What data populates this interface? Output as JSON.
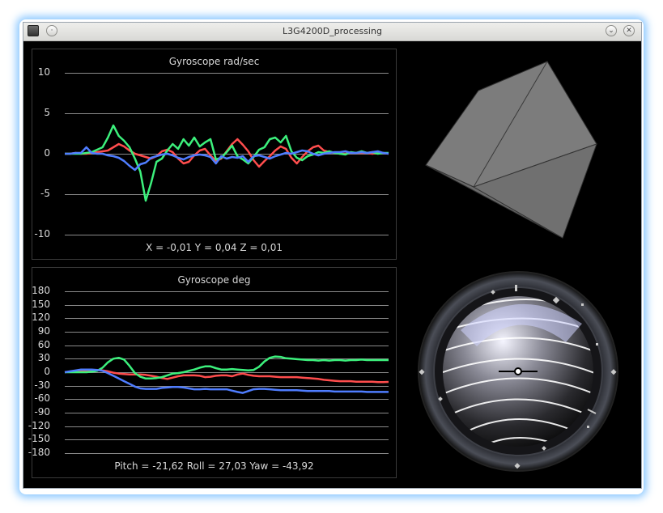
{
  "window": {
    "title": "L3G4200D_processing"
  },
  "colors": {
    "x_series": "#ff4d4d",
    "y_series": "#3cf07c",
    "z_series": "#4f7dff",
    "grid": "#8a8a8a",
    "text": "#d8d8d8"
  },
  "icons": {
    "app": "app-icon",
    "menu": "menu-icon",
    "minimize": "chevron-down-icon",
    "close": "close-icon"
  },
  "chart_data": [
    {
      "type": "line",
      "title": "Gyroscope rad/sec",
      "xlabel": "",
      "ylabel": "",
      "ylim": [
        -10,
        10
      ],
      "y_ticks": [
        "10",
        "5",
        "0",
        "-5",
        "-10"
      ],
      "grid": true,
      "readout": "X = -0,01  Y = 0,04  Z = 0,01",
      "series": [
        {
          "color": "#ff4d4d",
          "values": [
            0,
            0,
            0.1,
            0,
            0,
            0.1,
            0.2,
            0.3,
            0.4,
            0.8,
            1.2,
            0.9,
            0.4,
            0,
            -0.2,
            -0.4,
            -0.6,
            -0.3,
            0.3,
            0.5,
            0.2,
            -0.6,
            -1.2,
            -1.0,
            -0.2,
            0.4,
            0.6,
            -0.2,
            -0.9,
            -0.6,
            0.3,
            1.2,
            1.8,
            1.1,
            0.3,
            -0.8,
            -1.6,
            -0.9,
            -0.3,
            0.4,
            0.9,
            0.6,
            -0.5,
            -1.2,
            -0.4,
            0.3,
            0.8,
            1.0,
            0.4,
            0.2,
            0.1,
            0,
            0,
            0.1,
            0.1,
            0.1,
            0.1,
            0,
            0.1,
            0.1,
            0
          ]
        },
        {
          "color": "#3cf07c",
          "values": [
            0,
            0,
            0,
            0,
            0.1,
            0.2,
            0.5,
            0.8,
            2.0,
            3.5,
            2.2,
            1.6,
            0.8,
            -0.6,
            -2.2,
            -5.8,
            -3.6,
            -1.0,
            -0.6,
            0.4,
            1.2,
            0.6,
            1.8,
            1.0,
            2.0,
            0.9,
            1.4,
            1.8,
            -0.7,
            -0.5,
            0.2,
            1.0,
            -0.3,
            -0.7,
            -1.2,
            -0.4,
            0.5,
            0.8,
            1.8,
            2.0,
            1.4,
            2.2,
            0.3,
            -0.5,
            -0.8,
            -0.3,
            -0.1,
            0.2,
            0.1,
            0.3,
            0.1,
            0,
            -0.1,
            0.2,
            0.1,
            0.3,
            0.1,
            0.2,
            0,
            0.1,
            0.1
          ]
        },
        {
          "color": "#4f7dff",
          "values": [
            0,
            0,
            0.1,
            0.1,
            0.8,
            0.1,
            0,
            0,
            -0.2,
            -0.3,
            -0.5,
            -0.9,
            -1.5,
            -2.0,
            -1.3,
            -1.1,
            -0.5,
            -0.3,
            -0.1,
            0,
            -0.2,
            -0.5,
            -0.7,
            -0.4,
            -0.2,
            -0.1,
            -0.2,
            -0.4,
            -1.2,
            -0.3,
            -0.6,
            -0.4,
            -0.5,
            -0.3,
            -1.0,
            -0.3,
            -0.2,
            -0.4,
            -0.6,
            -0.3,
            -0.1,
            0.1,
            0,
            0.2,
            0.4,
            0.3,
            0,
            -0.2,
            0,
            0.1,
            0.2,
            0.2,
            0.3,
            0.1,
            0.1,
            0.2,
            0.1,
            0.2,
            0.3,
            0.1,
            0
          ]
        }
      ]
    },
    {
      "type": "line",
      "title": "Gyroscope deg",
      "xlabel": "",
      "ylabel": "",
      "ylim": [
        -180,
        180
      ],
      "y_ticks": [
        "180",
        "150",
        "120",
        "90",
        "60",
        "30",
        "0",
        "-30",
        "-60",
        "-90",
        "-120",
        "-150",
        "-180"
      ],
      "grid": true,
      "readout": "Pitch = -21,62  Roll = 27,03  Yaw = -43,92",
      "series": [
        {
          "color": "#ff4d4d",
          "values": [
            0,
            1,
            2,
            3,
            4,
            5,
            5,
            4,
            2,
            -1,
            -3,
            -4,
            -5,
            -5,
            -5,
            -6,
            -8,
            -10,
            -13,
            -15,
            -12,
            -9,
            -7,
            -7,
            -7,
            -8,
            -11,
            -10,
            -8,
            -7,
            -7,
            -9,
            -5,
            -3,
            -6,
            -8,
            -9,
            -9,
            -9,
            -10,
            -11,
            -11,
            -11,
            -11,
            -12,
            -13,
            -14,
            -15,
            -17,
            -18,
            -19,
            -20,
            -20,
            -20,
            -21,
            -21,
            -21,
            -21,
            -22,
            -22,
            -21.6
          ]
        },
        {
          "color": "#3cf07c",
          "values": [
            0,
            0,
            0,
            0,
            0,
            1,
            3,
            10,
            22,
            30,
            32,
            28,
            14,
            -2,
            -10,
            -14,
            -14,
            -13,
            -11,
            -7,
            -3,
            -2,
            0,
            3,
            6,
            10,
            13,
            13,
            9,
            6,
            6,
            7,
            6,
            5,
            4,
            5,
            12,
            24,
            32,
            35,
            34,
            31,
            30,
            29,
            28,
            27,
            27,
            26,
            27,
            26,
            27,
            27,
            26,
            27,
            27,
            28,
            27,
            27,
            27,
            27,
            27.0
          ]
        },
        {
          "color": "#4f7dff",
          "values": [
            0,
            2,
            4,
            6,
            6,
            6,
            5,
            3,
            -2,
            -8,
            -14,
            -20,
            -26,
            -32,
            -36,
            -37,
            -37,
            -37,
            -35,
            -34,
            -33,
            -33,
            -34,
            -36,
            -38,
            -38,
            -37,
            -38,
            -38,
            -38,
            -38,
            -41,
            -44,
            -46,
            -42,
            -38,
            -37,
            -37,
            -38,
            -39,
            -40,
            -40,
            -40,
            -40,
            -41,
            -42,
            -42,
            -42,
            -42,
            -42,
            -43,
            -43,
            -43,
            -43,
            -43,
            -43,
            -44,
            -44,
            -44,
            -44,
            -43.92
          ]
        }
      ]
    }
  ]
}
